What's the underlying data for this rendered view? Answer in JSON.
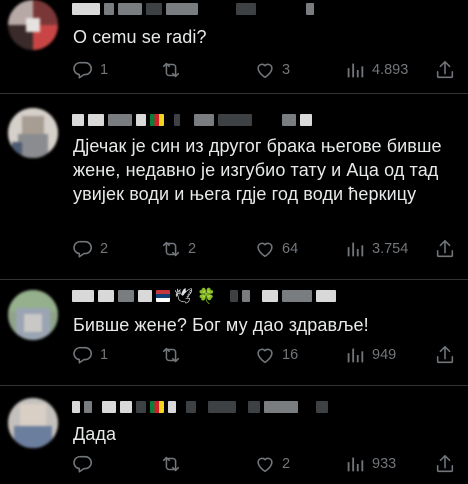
{
  "tweets": [
    {
      "text": "O cemu se radi?",
      "stats": {
        "replies": "1",
        "retweets": "",
        "likes": "3",
        "views": "4.893"
      }
    },
    {
      "text": "Дјечак је син из другог брака његове бивше жене, недавно је изгубио тату и Аца од тад увијек води и њега гдје год води ћеркицу",
      "stats": {
        "replies": "2",
        "retweets": "2",
        "likes": "64",
        "views": "3.754"
      }
    },
    {
      "text": "Бивше жене? Бог му дао здравље!",
      "stats": {
        "replies": "1",
        "retweets": "",
        "likes": "16",
        "views": "949"
      }
    },
    {
      "text": "Дада",
      "stats": {
        "replies": "",
        "retweets": "",
        "likes": "2",
        "views": "933"
      }
    }
  ],
  "icons": {
    "reply": "reply-icon",
    "retweet": "retweet-icon",
    "like": "like-icon",
    "views": "views-icon",
    "share": "share-icon"
  },
  "emoji": {
    "dove": "🕊",
    "clover": "🍀"
  },
  "colors": {
    "background": "#000000",
    "text": "#e7e9ea",
    "muted": "#71767b",
    "divider": "#2f3336"
  }
}
